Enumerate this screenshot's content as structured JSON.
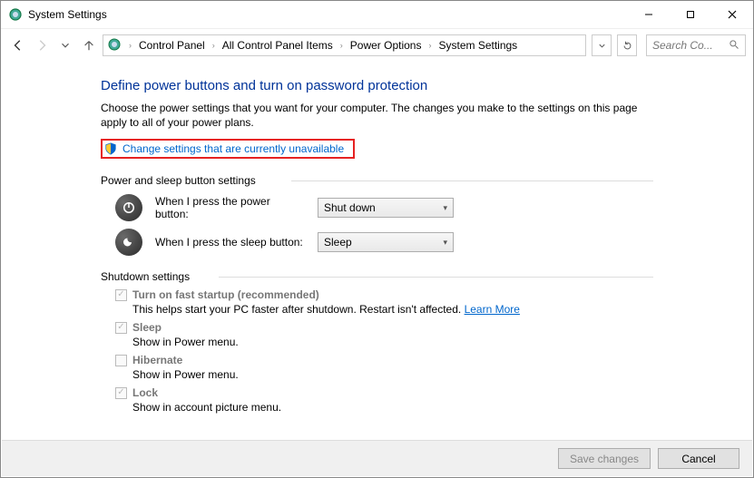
{
  "window": {
    "title": "System Settings"
  },
  "breadcrumbs": {
    "items": [
      "Control Panel",
      "All Control Panel Items",
      "Power Options",
      "System Settings"
    ]
  },
  "search": {
    "placeholder": "Search Co..."
  },
  "page": {
    "heading": "Define power buttons and turn on password protection",
    "intro": "Choose the power settings that you want for your computer. The changes you make to the settings on this page apply to all of your power plans.",
    "change_link": "Change settings that are currently unavailable"
  },
  "sections": {
    "power_sleep": {
      "title": "Power and sleep button settings",
      "rows": [
        {
          "label": "When I press the power button:",
          "value": "Shut down"
        },
        {
          "label": "When I press the sleep button:",
          "value": "Sleep"
        }
      ]
    },
    "shutdown": {
      "title": "Shutdown settings",
      "items": [
        {
          "checked": true,
          "title": "Turn on fast startup (recommended)",
          "desc": "This helps start your PC faster after shutdown. Restart isn't affected. ",
          "link": "Learn More"
        },
        {
          "checked": true,
          "title": "Sleep",
          "desc": "Show in Power menu."
        },
        {
          "checked": false,
          "title": "Hibernate",
          "desc": "Show in Power menu."
        },
        {
          "checked": true,
          "title": "Lock",
          "desc": "Show in account picture menu."
        }
      ]
    }
  },
  "buttons": {
    "save": "Save changes",
    "cancel": "Cancel"
  }
}
